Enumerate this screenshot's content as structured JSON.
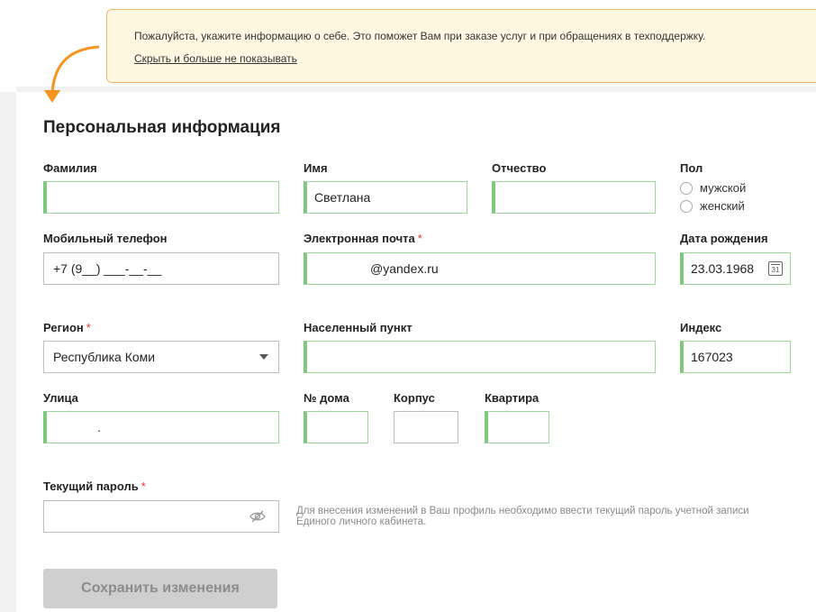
{
  "hint": {
    "text": "Пожалуйста, укажите информацию о себе. Это поможет Вам при заказе услуг и при обращениях в техподдержку.",
    "hide_link": "Скрыть и больше не показывать"
  },
  "form": {
    "title": "Персональная информация",
    "surname": {
      "label": "Фамилия",
      "value": ""
    },
    "first_name": {
      "label": "Имя",
      "value": "Светлана"
    },
    "patronymic": {
      "label": "Отчество",
      "value": ""
    },
    "gender": {
      "label": "Пол",
      "options": [
        "мужской",
        "женский"
      ]
    },
    "mobile": {
      "label": "Мобильный телефон",
      "value": "+7 (9__) ___-__-__"
    },
    "email": {
      "label": "Электронная почта",
      "required_mark": "*",
      "value": "@yandex.ru"
    },
    "birthdate": {
      "label": "Дата рождения",
      "value": "23.03.1968",
      "calendar_day": "31"
    },
    "region": {
      "label": "Регион",
      "required_mark": "*",
      "value": "Республика Коми"
    },
    "locality": {
      "label": "Населенный пункт",
      "value": ""
    },
    "postcode": {
      "label": "Индекс",
      "value": "167023"
    },
    "street": {
      "label": "Улица",
      "value": "."
    },
    "house": {
      "label": "№ дома",
      "value": ""
    },
    "building": {
      "label": "Корпус",
      "value": ""
    },
    "apartment": {
      "label": "Квартира",
      "value": ""
    },
    "password": {
      "label": "Текущий пароль",
      "required_mark": "*",
      "value": "",
      "note": "Для внесения изменений в Ваш профиль необходимо ввести текущий пароль учетной записи Единого личного кабинета."
    },
    "save_label": "Сохранить изменения"
  },
  "colors": {
    "accent_orange": "#f7941d",
    "valid_green": "#7ec97e",
    "required_red": "#e53935",
    "hint_bg": "#fff8e1"
  },
  "icons": [
    "arrow-icon",
    "chevron-down-icon",
    "calendar-icon",
    "eye-off-icon"
  ]
}
